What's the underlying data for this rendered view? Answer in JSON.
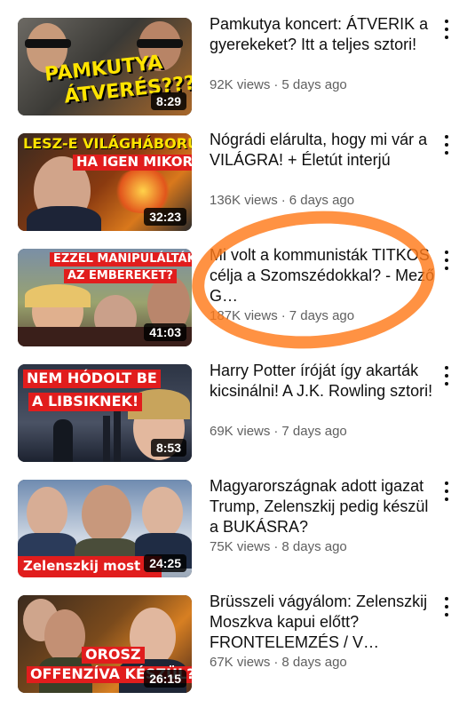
{
  "videos": [
    {
      "title": "Pamkutya koncert: ÁTVERIK a gyerekeket? Itt a teljes sztori!",
      "views": "92K views",
      "age": "5 days ago",
      "duration": "8:29",
      "thumb_text": [
        "PAMKUTYA",
        "ÁTVERÉS???"
      ]
    },
    {
      "title": "Nógrádi elárulta, hogy mi vár a VILÁGRA! + Életút interjú",
      "views": "136K views",
      "age": "6 days ago",
      "duration": "32:23",
      "thumb_text": [
        "LESZ-E VILÁGHÁBORÚ,",
        "HA IGEN MIKOR?"
      ]
    },
    {
      "title": "Mi volt a kommunisták TITKOS célja a Szomszédokkal? - Mező G…",
      "views": "187K views",
      "age": "7 days ago",
      "duration": "41:03",
      "thumb_text": [
        "EZZEL MANIPULÁLTÁK",
        "AZ EMBEREKET?"
      ]
    },
    {
      "title": "Harry Potter íróját így akarták kicsinálni! A J.K. Rowling sztori!",
      "views": "69K views",
      "age": "7 days ago",
      "duration": "8:53",
      "thumb_text": [
        "NEM HÓDOLT BE",
        "A LIBSIKNEK!"
      ]
    },
    {
      "title": "Magyarországnak adott igazat Trump, Zelenszkij pedig készül a BUKÁSRA?",
      "views": "75K views",
      "age": "8 days ago",
      "duration": "24:25",
      "thumb_text": [
        "Zelenszkij most"
      ]
    },
    {
      "title": "Brüsszeli vágyálom: Zelenszkij Moszkva kapui előtt? FRONTELEMZÉS / V…",
      "views": "67K views",
      "age": "8 days ago",
      "duration": "26:15",
      "thumb_text": [
        "OROSZ",
        "OFFENZÍVA KÉSZÜL?"
      ]
    }
  ],
  "dot_separator": "·",
  "colors": {
    "annotation": "#ff7a1a",
    "meta_text": "#606060",
    "title_text": "#0f0f0f",
    "thumb_yellow": "#ffe400",
    "thumb_red": "#e11d1d"
  },
  "icons": [
    "more-vert-icon"
  ]
}
